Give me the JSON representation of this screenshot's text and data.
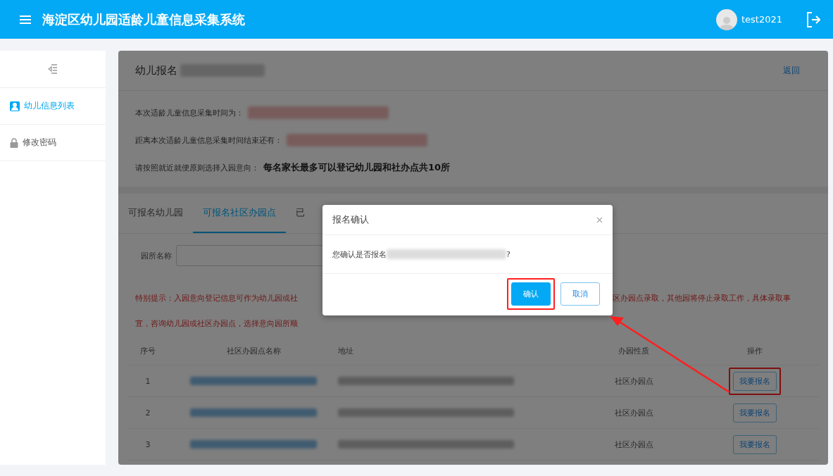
{
  "header": {
    "title": "海淀区幼儿园适龄儿童信息采集系统",
    "username": "test2021"
  },
  "sidebar": {
    "items": [
      {
        "label": "幼儿信息列表",
        "selected": true
      },
      {
        "label": "修改密码",
        "selected": false
      }
    ]
  },
  "page": {
    "title": "幼儿报名",
    "back_link": "返回",
    "info": [
      {
        "label": "本次适龄儿童信息采集时间为：",
        "value_hidden": true
      },
      {
        "label": "距离本次适龄儿童信息采集时间结束还有：",
        "value_hidden": true
      },
      {
        "label": "请按照就近就便原则选择入园意向：",
        "value_hidden": false,
        "emphasis": "每名家长最多可以登记幼儿园和社办点共10所"
      }
    ]
  },
  "tabs": [
    {
      "label": "可报名幼儿园",
      "selected": false
    },
    {
      "label": "可报名社区办园点",
      "selected": true
    },
    {
      "label": "已",
      "selected": false
    }
  ],
  "search": {
    "label": "园所名称"
  },
  "notice": {
    "left_lines": [
      "特别提示：入园意向登记信息可作为幼儿园或社",
      "宜，咨询幼儿园或社区办园点，选择意向园所顺"
    ],
    "right_lines": [
      "区办园点录取，其他园将停止录取工作，具体录取事"
    ]
  },
  "table": {
    "columns": [
      "序号",
      "社区办园点名称",
      "地址",
      "办园性质",
      "操作"
    ],
    "rows": [
      {
        "index": "1",
        "type": "社区办园点",
        "action": "我要报名",
        "highlighted": true
      },
      {
        "index": "2",
        "type": "社区办园点",
        "action": "我要报名",
        "highlighted": false
      },
      {
        "index": "3",
        "type": "社区办园点",
        "action": "我要报名",
        "highlighted": false
      }
    ]
  },
  "dialog": {
    "title": "报名确认",
    "message_prefix": "您确认是否报名",
    "message_suffix": "?",
    "buttons": [
      {
        "label": "确认",
        "kind": "primary",
        "highlighted": true
      },
      {
        "label": "取消",
        "kind": "default",
        "highlighted": false
      }
    ]
  }
}
